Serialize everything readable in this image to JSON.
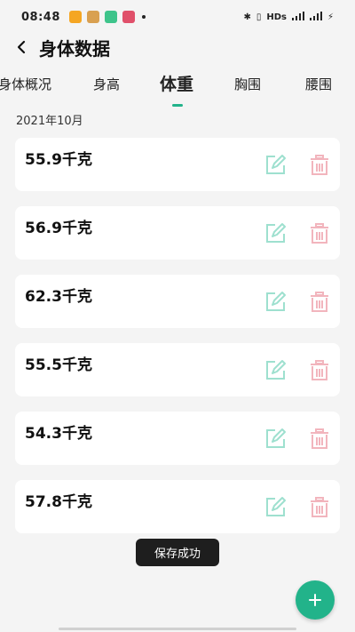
{
  "status_bar": {
    "time": "08:48",
    "right_text": "HDs",
    "signal1": "5G",
    "signal2": "4G"
  },
  "header": {
    "title": "身体数据"
  },
  "tabs": [
    {
      "label": "身体概况"
    },
    {
      "label": "身高"
    },
    {
      "label": "体重"
    },
    {
      "label": "胸围"
    },
    {
      "label": "腰围"
    }
  ],
  "active_tab": "体重",
  "month": "2021年10月",
  "records": [
    {
      "weight": "55.9千克"
    },
    {
      "weight": "56.9千克"
    },
    {
      "weight": "62.3千克"
    },
    {
      "weight": "55.5千克"
    },
    {
      "weight": "54.3千克"
    },
    {
      "weight": "57.8千克"
    }
  ],
  "toast": "保存成功",
  "colors": {
    "accent": "#22b38a",
    "edit_icon": "#9ee0cf",
    "delete_icon": "#f2b5bd",
    "toast_bg": "#1e1e1e"
  },
  "icons": {
    "edit": "edit-icon",
    "delete": "trash-icon",
    "add": "plus-icon",
    "back": "back-arrow-icon"
  }
}
